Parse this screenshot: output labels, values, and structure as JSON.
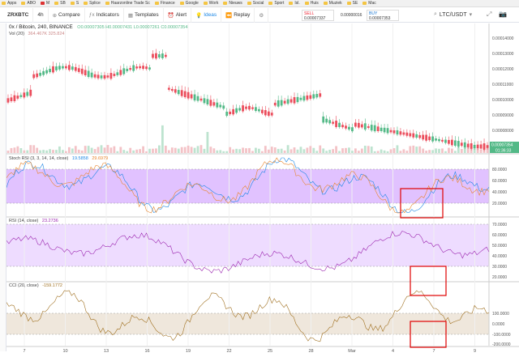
{
  "bookmarks": [
    {
      "label": "Apps",
      "icon": "apps-icon"
    },
    {
      "label": "ABO",
      "icon": "folder-icon"
    },
    {
      "label": "M",
      "icon": "gmail-icon"
    },
    {
      "label": "SB",
      "icon": "folder-icon"
    },
    {
      "label": "S",
      "icon": "folder-icon"
    },
    {
      "label": "Splice",
      "icon": "folder-icon"
    },
    {
      "label": "Haarzonline Trade Sc",
      "icon": "folder-icon"
    },
    {
      "label": "Finance",
      "icon": "folder-icon"
    },
    {
      "label": "Google",
      "icon": "folder-icon"
    },
    {
      "label": "Work",
      "icon": "folder-icon"
    },
    {
      "label": "Nieuws",
      "icon": "folder-icon"
    },
    {
      "label": "Social",
      "icon": "folder-icon"
    },
    {
      "label": "Sport",
      "icon": "folder-icon"
    },
    {
      "label": "Isl.",
      "icon": "folder-icon"
    },
    {
      "label": "Huis",
      "icon": "folder-icon"
    },
    {
      "label": "Muziek",
      "icon": "folder-icon"
    },
    {
      "label": "SE",
      "icon": "folder-icon"
    },
    {
      "label": "Mac",
      "icon": "folder-icon"
    }
  ],
  "toolbar": {
    "symbol": "ZRXBTC",
    "interval": "4h",
    "compare": "Compare",
    "indicators": "Indicators",
    "templates": "Templates",
    "alert": "Alert",
    "ideas": "Ideas",
    "replay": "Replay",
    "sell_label": "SELL",
    "sell_price": "0.00007337",
    "spread": "0.00000016",
    "buy_label": "BUY",
    "buy_price": "0.00007353",
    "pair_select": "LTC/USDT"
  },
  "main": {
    "title": "0x / Bitcoin, 240, BINANCE",
    "ohlc": "O0.00007305  H0.00007431  L0.00007261  C0.00007354",
    "vol_label": "Vol (20)",
    "vol_values": "364.467K  325.824",
    "price_ticks": [
      "0.00014000",
      "0.00013000",
      "0.00012000",
      "0.00011000",
      "0.00010000",
      "0.00009000",
      "0.00008000"
    ],
    "last_price": "0.00007354",
    "timer": "01:36:33"
  },
  "stoch": {
    "label": "Stoch RSI (3, 3, 14, 14, close)",
    "value1": "19.5858",
    "value2": "29.6979",
    "ticks": [
      "80.0000",
      "60.0000",
      "40.0000",
      "20.0000"
    ]
  },
  "rsi": {
    "label": "RSI (14, close)",
    "value": "23.2736",
    "ticks": [
      "70.0000",
      "60.0000",
      "50.0000",
      "40.0000",
      "30.0000",
      "20.0000"
    ]
  },
  "cci": {
    "label": "CCI (20, close)",
    "value": "-159.1772",
    "ticks": [
      "100.0000",
      "0.0000",
      "-100.0000",
      "-200.0000"
    ]
  },
  "time_axis": [
    "7",
    "10",
    "13",
    "16",
    "19",
    "22",
    "25",
    "28",
    "Mar",
    "4",
    "7",
    "9"
  ],
  "colors": {
    "up": "#53b987",
    "down": "#eb4d5c",
    "stoch_band": "#d9b3ff",
    "rsi_band": "#eedcff",
    "cci_band": "#efe7dc",
    "highlight": "#e00000"
  }
}
